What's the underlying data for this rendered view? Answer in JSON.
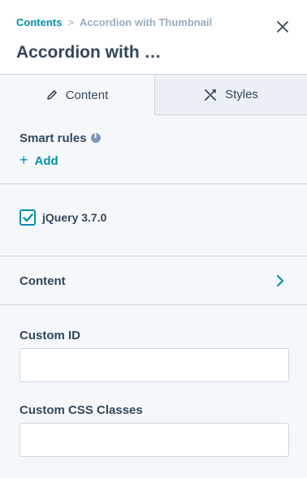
{
  "breadcrumb": {
    "parent": "Contents",
    "separator": ">",
    "current": "Accordion with Thumbnail"
  },
  "header": {
    "title": "Accordion with …",
    "close_icon": "close-icon"
  },
  "tabs": [
    {
      "label": "Content",
      "icon": "pencil-icon",
      "active": true
    },
    {
      "label": "Styles",
      "icon": "styles-icon",
      "active": false
    }
  ],
  "smart_rules": {
    "label": "Smart rules",
    "info_icon": "info-icon",
    "add_label": "Add"
  },
  "jquery": {
    "label": "jQuery 3.7.0",
    "checked": true
  },
  "content_section": {
    "label": "Content"
  },
  "custom_id": {
    "label": "Custom ID",
    "value": ""
  },
  "custom_css": {
    "label": "Custom CSS Classes",
    "value": ""
  },
  "colors": {
    "accent": "#0091ae",
    "text": "#33475b",
    "muted": "#99acc2",
    "border": "#cbd6e2",
    "background": "#f5f8fa"
  }
}
